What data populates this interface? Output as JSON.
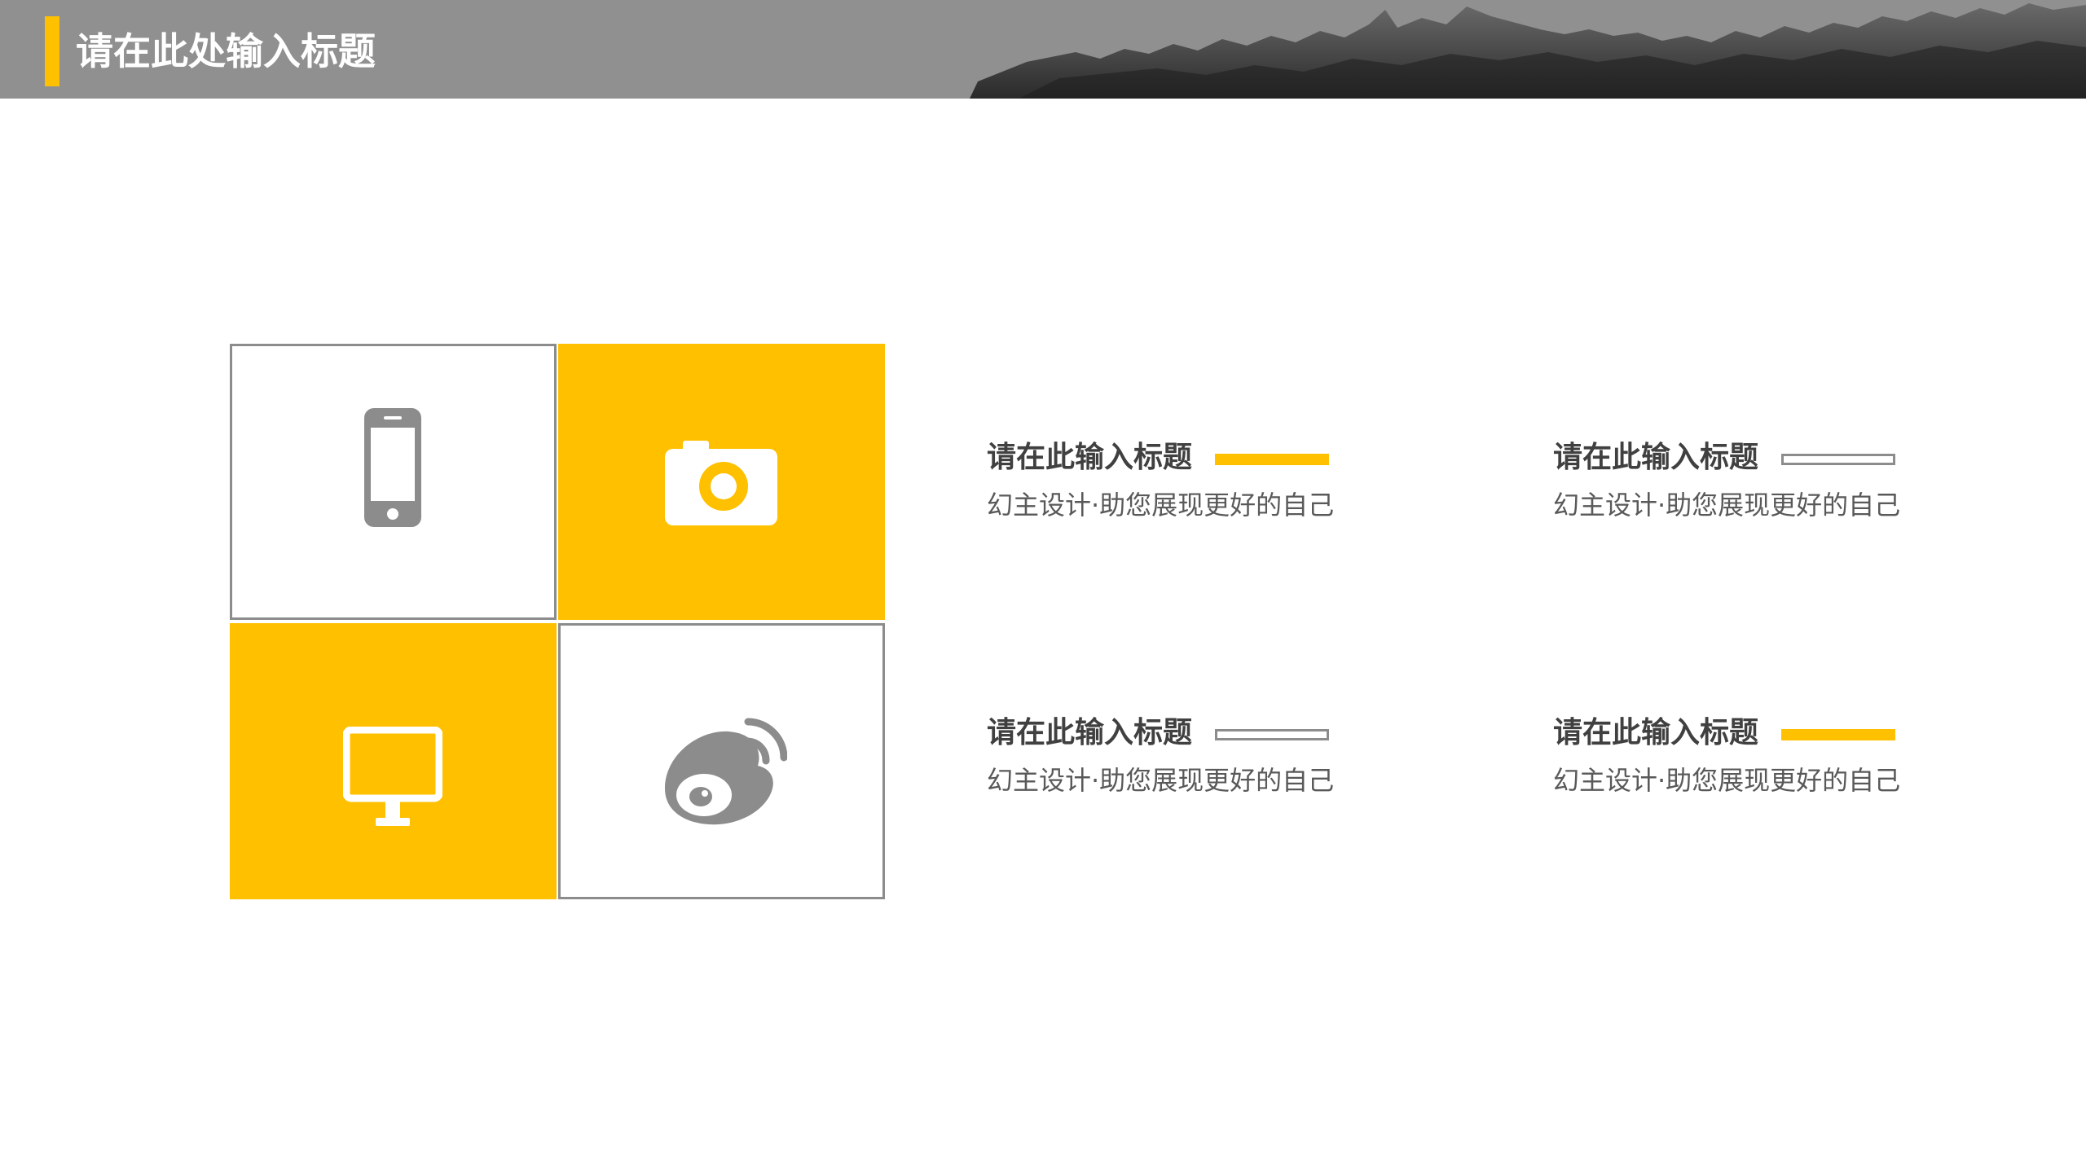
{
  "header": {
    "title": "请在此处输入标题"
  },
  "colors": {
    "accent": "#FFC000",
    "gray": "#8C8C8C",
    "header_bg": "#909090",
    "text_dark": "#404040",
    "text_body": "#595959"
  },
  "grid": {
    "cells": [
      {
        "icon": "mobile-phone-icon",
        "style": "outline"
      },
      {
        "icon": "camera-icon",
        "style": "filled"
      },
      {
        "icon": "monitor-icon",
        "style": "filled"
      },
      {
        "icon": "weibo-icon",
        "style": "outline"
      }
    ]
  },
  "items": [
    {
      "title": "请在此输入标题",
      "desc": "幻主设计·助您展现更好的自己",
      "line": "solid"
    },
    {
      "title": "请在此输入标题",
      "desc": "幻主设计·助您展现更好的自己",
      "line": "hollow"
    },
    {
      "title": "请在此输入标题",
      "desc": "幻主设计·助您展现更好的自己",
      "line": "hollow"
    },
    {
      "title": "请在此输入标题",
      "desc": "幻主设计·助您展现更好的自己",
      "line": "solid"
    }
  ]
}
